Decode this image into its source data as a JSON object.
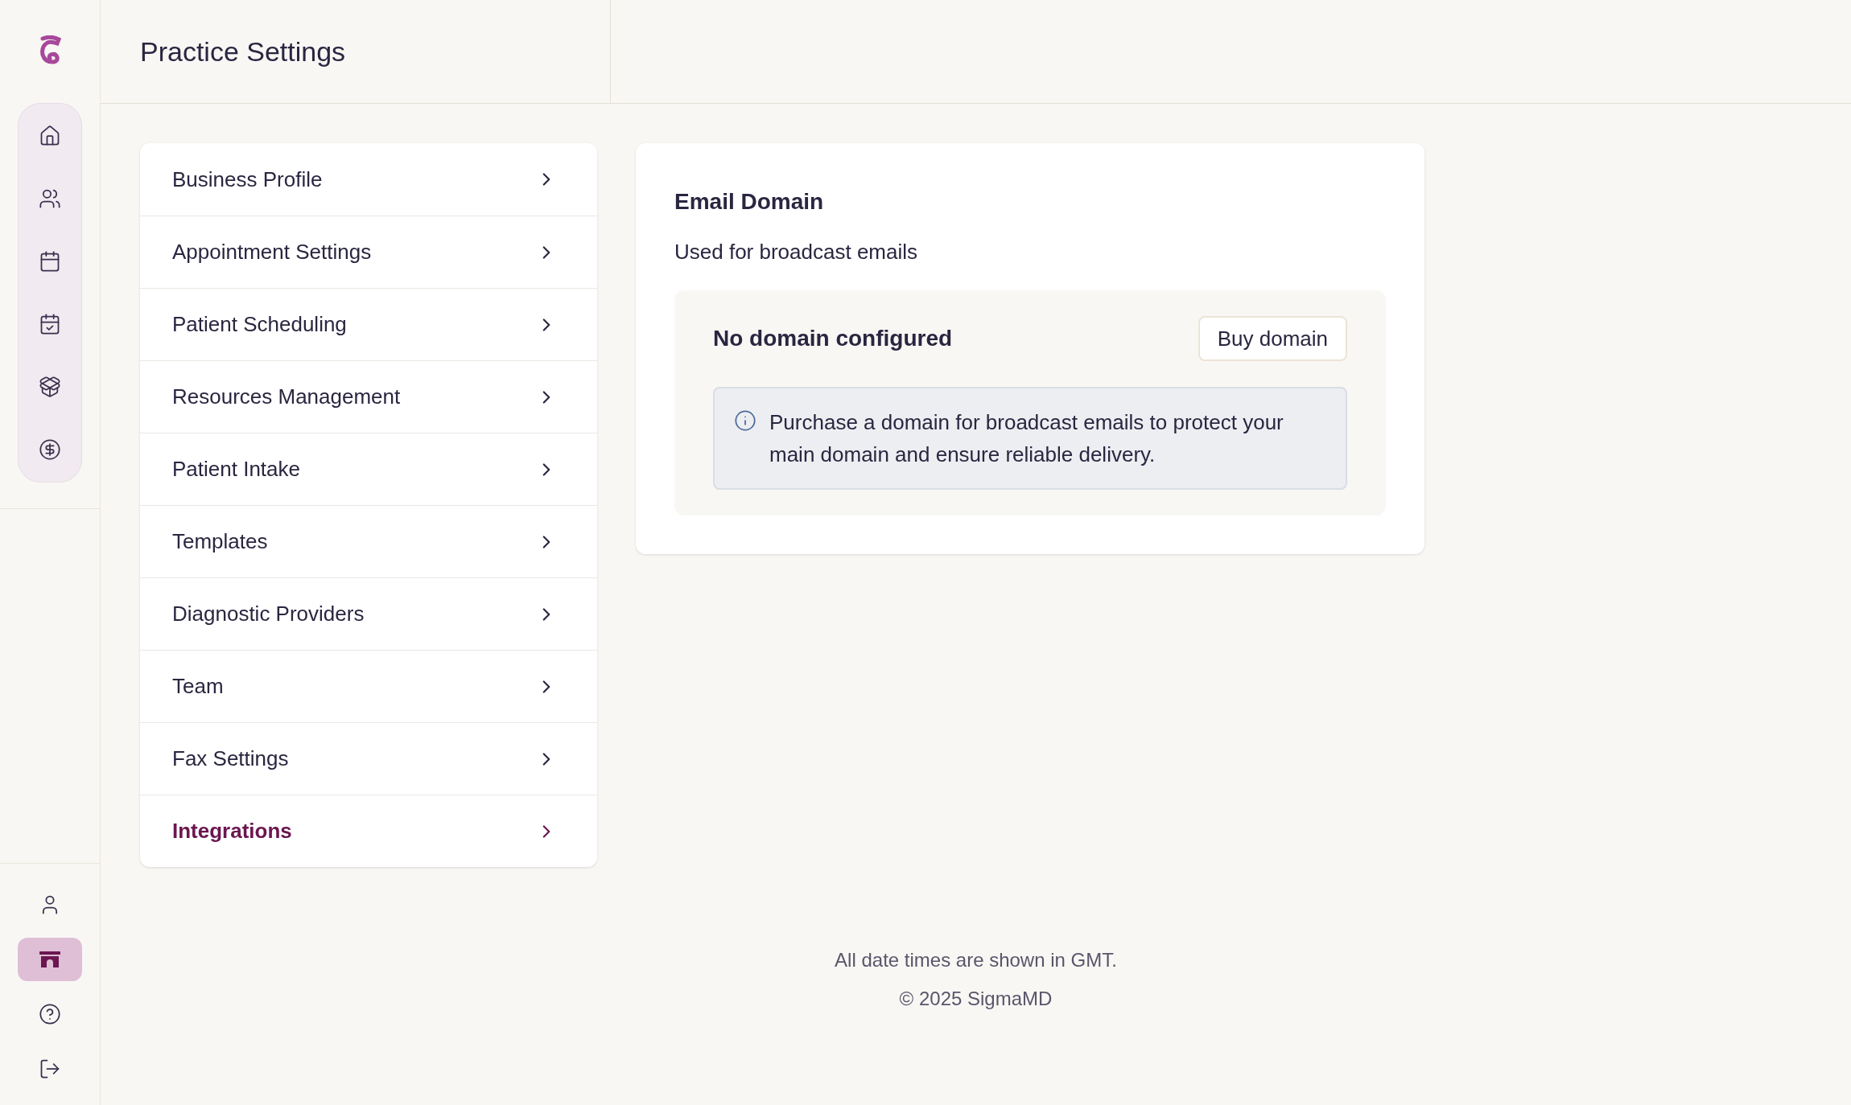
{
  "sidebar": {
    "main_items": [
      {
        "selected": false
      },
      {
        "selected": false
      },
      {
        "selected": false
      },
      {
        "selected": false
      },
      {
        "selected": false
      },
      {
        "selected": false
      }
    ],
    "bottom_items": [
      {
        "selected": false
      },
      {
        "selected": true
      },
      {
        "selected": false
      },
      {
        "selected": false
      }
    ]
  },
  "header": {
    "title": "Practice Settings"
  },
  "settings_menu": [
    {
      "label": "Business Profile",
      "selected": false
    },
    {
      "label": "Appointment Settings",
      "selected": false
    },
    {
      "label": "Patient Scheduling",
      "selected": false
    },
    {
      "label": "Resources Management",
      "selected": false
    },
    {
      "label": "Patient Intake",
      "selected": false
    },
    {
      "label": "Templates",
      "selected": false
    },
    {
      "label": "Diagnostic Providers",
      "selected": false
    },
    {
      "label": "Team",
      "selected": false
    },
    {
      "label": "Fax Settings",
      "selected": false
    },
    {
      "label": "Integrations",
      "selected": true
    }
  ],
  "email_domain": {
    "title": "Email Domain",
    "subtitle": "Used for broadcast emails",
    "status": "No domain configured",
    "button": "Buy domain",
    "info": "Purchase a domain for broadcast emails to protect your main domain and ensure reliable delivery."
  },
  "footer": {
    "lines": [
      "All date times are shown in GMT.",
      "© 2025 SigmaMD"
    ]
  }
}
